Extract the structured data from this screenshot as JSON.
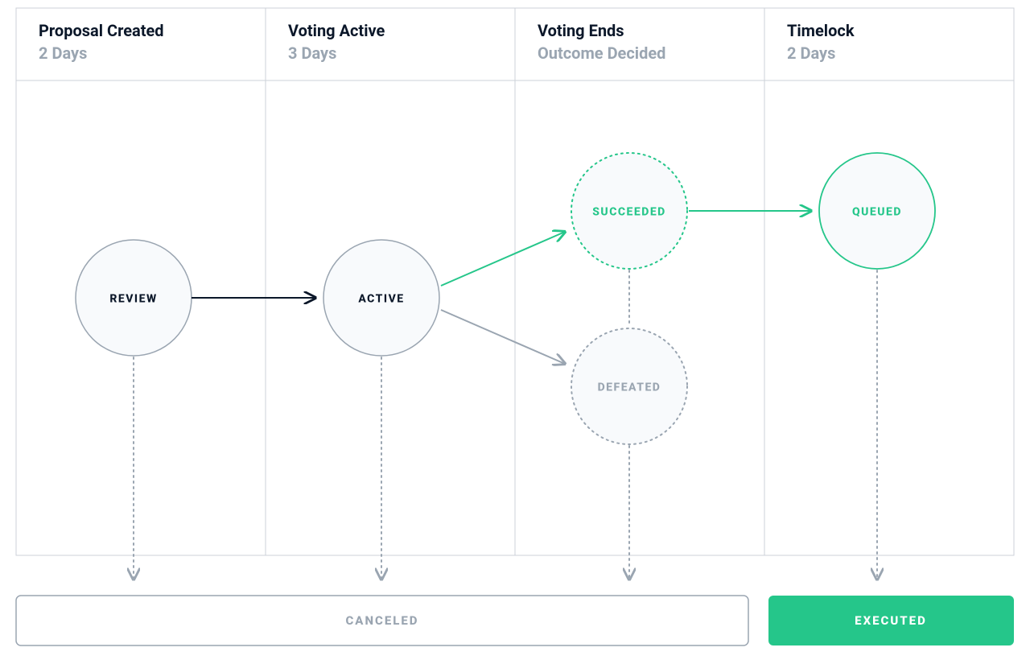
{
  "colors": {
    "accent": "#25c68a",
    "muted": "#9aa5b1",
    "line": "#ccd2d8",
    "dark": "#0b1729",
    "nodeFill": "#f8fafc"
  },
  "columns": [
    {
      "title": "Proposal Created",
      "subtitle": "2 Days"
    },
    {
      "title": "Voting Active",
      "subtitle": "3 Days"
    },
    {
      "title": "Voting Ends",
      "subtitle": "Outcome Decided"
    },
    {
      "title": "Timelock",
      "subtitle": "2 Days"
    }
  ],
  "nodes": {
    "review": "REVIEW",
    "active": "ACTIVE",
    "succeeded": "SUCCEEDED",
    "defeated": "DEFEATED",
    "queued": "QUEUED"
  },
  "terminal": {
    "canceled": "CANCELED",
    "executed": "EXECUTED"
  }
}
